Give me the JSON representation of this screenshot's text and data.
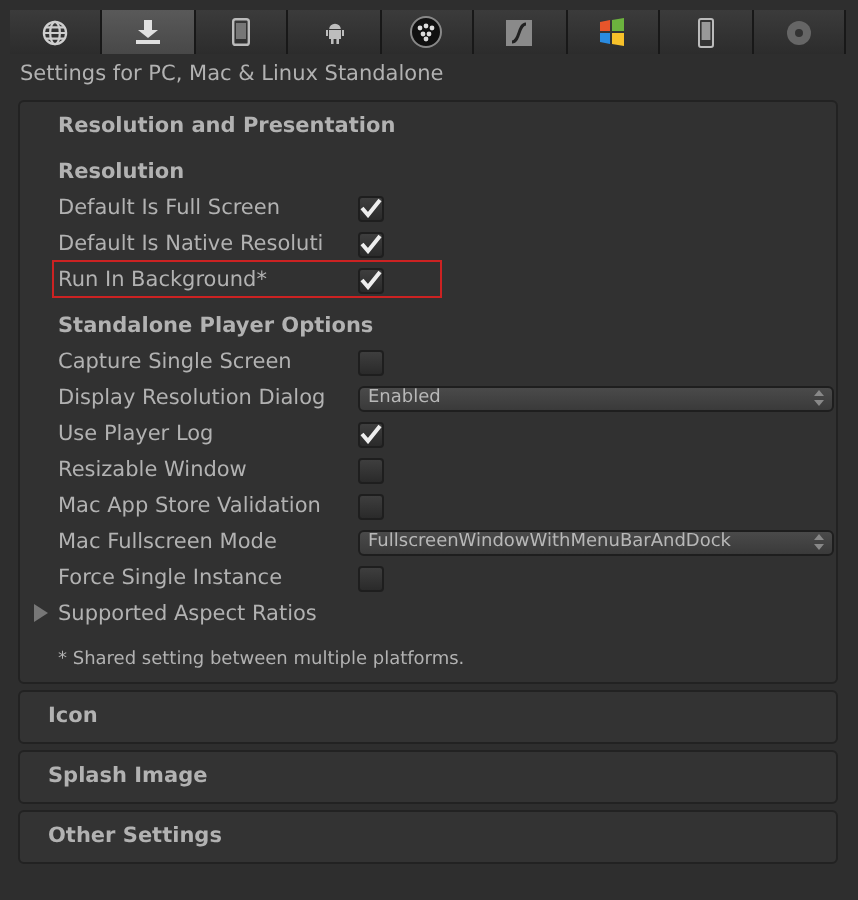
{
  "platform_tabs": [
    {
      "kind": "globe",
      "selected": false
    },
    {
      "kind": "download",
      "selected": true
    },
    {
      "kind": "phone",
      "selected": false
    },
    {
      "kind": "android",
      "selected": false
    },
    {
      "kind": "blackberry",
      "selected": false
    },
    {
      "kind": "flash",
      "selected": false
    },
    {
      "kind": "windows",
      "selected": false
    },
    {
      "kind": "windows-phone",
      "selected": false
    },
    {
      "kind": "disc",
      "selected": false
    }
  ],
  "title": "Settings for PC, Mac & Linux Standalone",
  "section": {
    "title": "Resolution and Presentation",
    "groups": [
      {
        "heading": "Resolution",
        "rows": [
          {
            "kind": "checkbox",
            "label": "Default Is Full Screen",
            "checked": true,
            "highlighted": false
          },
          {
            "kind": "checkbox",
            "label": "Default Is Native Resoluti",
            "checked": true,
            "highlighted": false
          },
          {
            "kind": "checkbox",
            "label": "Run In Background*",
            "checked": true,
            "highlighted": true
          }
        ]
      },
      {
        "heading": "Standalone Player Options",
        "rows": [
          {
            "kind": "checkbox",
            "label": "Capture Single Screen",
            "checked": false,
            "highlighted": false
          },
          {
            "kind": "dropdown",
            "label": "Display Resolution Dialog",
            "value": "Enabled",
            "highlighted": false
          },
          {
            "kind": "checkbox",
            "label": "Use Player Log",
            "checked": true,
            "highlighted": false
          },
          {
            "kind": "checkbox",
            "label": "Resizable Window",
            "checked": false,
            "highlighted": false
          },
          {
            "kind": "checkbox",
            "label": "Mac App Store Validation",
            "checked": false,
            "highlighted": false
          },
          {
            "kind": "dropdown",
            "label": "Mac Fullscreen Mode",
            "value": "FullscreenWindowWithMenuBarAndDock",
            "highlighted": false
          },
          {
            "kind": "checkbox",
            "label": "Force Single Instance",
            "checked": false,
            "highlighted": false
          },
          {
            "kind": "foldout",
            "label": "Supported Aspect Ratios",
            "expanded": false,
            "highlighted": false
          }
        ]
      }
    ],
    "note": "* Shared setting between multiple platforms."
  },
  "collapsed_sections": [
    {
      "title": "Icon"
    },
    {
      "title": "Splash Image"
    },
    {
      "title": "Other Settings"
    }
  ]
}
